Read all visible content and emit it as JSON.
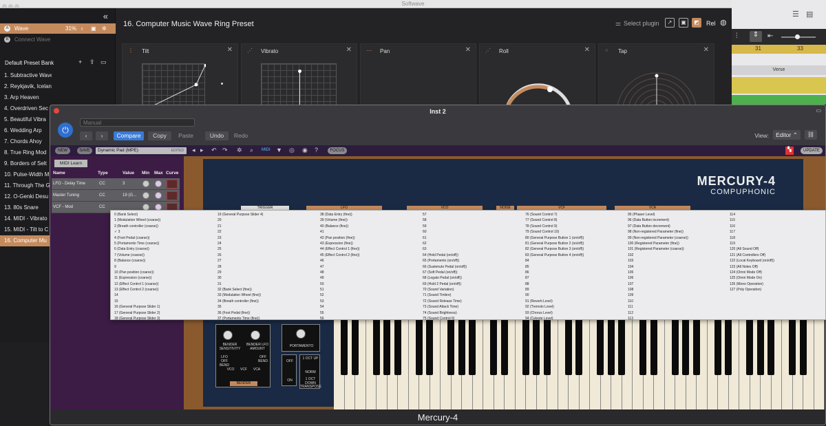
{
  "app": {
    "title": "Softwave"
  },
  "sidebar": {
    "plugins": [
      {
        "badge": "A",
        "name": "Wave",
        "percent": "31%"
      },
      {
        "badge": "B",
        "name": "Connect Wave"
      }
    ],
    "bank": "Default Preset Bank",
    "presets": [
      "1. Subtractive Waves",
      "2. Reykjavik, Iceland",
      "3. Arp Heaven",
      "4. Overdriven Sec",
      "5. Beautiful Vibra",
      "6. Wedding Arp",
      "7. Chords Ahoy",
      "8. True Ring Mod",
      "9. Borders of Selt",
      "10. Pulse-Width M",
      "11. Through The G",
      "12. O-Genki Desu",
      "13. 80s Snare",
      "14. MIDI - Vibrato",
      "15. MIDI - Tilt to C",
      "16. Computer Mu"
    ],
    "selected_index": 15
  },
  "main": {
    "title": "16. Computer Music Wave Ring Preset",
    "select_plugin": "Select plugin",
    "rel_label": "Rel",
    "cards": [
      "Tilt",
      "Vibrato",
      "Pan",
      "Roll",
      "Tap"
    ]
  },
  "daw": {
    "bar31": "31",
    "bar33": "33",
    "section": "Verse"
  },
  "inst": {
    "window_title": "Inst 2",
    "preset_dropdown": "Manual",
    "buttons": {
      "compare": "Compare",
      "copy": "Copy",
      "paste": "Paste",
      "undo": "Undo",
      "redo": "Redo"
    },
    "view_label": "View:",
    "view_value": "Editor",
    "footer": "Mercury-4"
  },
  "mercury": {
    "toolbar": {
      "new": "NEW",
      "save": "SAVE",
      "preset": "Dynamic Pad (MPE)",
      "edited": "EDITED",
      "focus": "FOCUS",
      "update": "UPDATE",
      "midi": "MIDI"
    },
    "midi_learn": "MIDI Learn",
    "table_headers": [
      "Name",
      "Type",
      "Value",
      "Min",
      "Max",
      "Curve"
    ],
    "rows": [
      {
        "name": "LFO - Delay Time",
        "type": "CC",
        "value": "3"
      },
      {
        "name": "Master Tuning",
        "type": "CC",
        "value": "19 (G..."
      },
      {
        "name": "VCF - Mod",
        "type": "CC",
        "value": ""
      }
    ],
    "logo": "MERCURY-4",
    "brand": "COMPUPHONIC",
    "section_labels": [
      "TRIGGER",
      "LFO",
      "VCO",
      "NOISE",
      "VCF",
      "VCA"
    ],
    "bender": {
      "label": "BENDER",
      "sens": "BENDER SENSITIVITY",
      "lfo": "BENDER LFO AMOUNT",
      "lfo_off_bend": "LFO OFF BEND",
      "off_bend": "OFF BEND",
      "vco": "VCO",
      "vcf": "VCF",
      "vca": "VCA"
    },
    "portamento": {
      "label": "PORTAMENTO",
      "off": "OFF",
      "on": "ON"
    },
    "transpose": {
      "label": "TRANSPOSE",
      "up": "1 OCT UP",
      "norm": "NORM",
      "down": "1 OCT DOWN"
    }
  },
  "cc_menu": {
    "columns": [
      [
        "0 (Bank Select)",
        "1 (Modulation Wheel (coarse))",
        "2 (Breath controller (coarse))",
        "✓ 3",
        "4 (Foot Pedal (coarse))",
        "5 (Portamento Time (coarse))",
        "6 (Data Entry (coarse))",
        "7 (Volume (coarse))",
        "8 (Balance (coarse))",
        "9",
        "10 (Pan position (coarse))",
        "11 (Expression (coarse))",
        "12 (Effect Control 1 (coarse))",
        "13 (Effect Control 2 (coarse))",
        "14",
        "15",
        "16 (General Purpose Slider 1)",
        "17 (General Purpose Slider 2)",
        "18 (General Purpose Slider 3)"
      ],
      [
        "19 (General Purpose Slider 4)",
        "20",
        "21",
        "22",
        "23",
        "24",
        "25",
        "26",
        "27",
        "28",
        "29",
        "30",
        "31",
        "32 (Bank Select (fine))",
        "33 (Modulation Wheel (fine))",
        "34 (Breath controller (fine))",
        "35",
        "36 (Foot Pedal (fine))",
        "37 (Portamento Time (fine))"
      ],
      [
        "38 (Data Entry (fine))",
        "39 (Volume (fine))",
        "40 (Balance (fine))",
        "41",
        "42 (Pan position (fine))",
        "43 (Expression (fine))",
        "44 (Effect Control 1 (fine))",
        "45 (Effect Control 2 (fine))",
        "46",
        "47",
        "48",
        "49",
        "50",
        "51",
        "52",
        "53",
        "54",
        "55",
        "56"
      ],
      [
        "57",
        "58",
        "59",
        "60",
        "61",
        "62",
        "63",
        "64 (Hold Pedal (on/off))",
        "65 (Portamento (on/off))",
        "66 (Sustenuto Pedal (on/off))",
        "67 (Soft Pedal (on/off))",
        "68 (Legato Pedal (on/off))",
        "69 (Hold 2 Pedal (on/off))",
        "70 (Sound Variation)",
        "71 (Sound Timbre)",
        "72 (Sound Release Time)",
        "73 (Sound Attack Time)",
        "74 (Sound Brightness)",
        "75 (Sound Control 6)"
      ],
      [
        "76 (Sound Control 7)",
        "77 (Sound Control 8)",
        "78 (Sound Control 9)",
        "79 (Sound Control 10)",
        "80 (General Purpose Button 1 (on/off))",
        "81 (General Purpose Button 2 (on/off))",
        "82 (General Purpose Button 3 (on/off))",
        "83 (General Purpose Button 4 (on/off))",
        "84",
        "85",
        "86",
        "87",
        "88",
        "89",
        "90",
        "91 (Reverb Level)",
        "92 (Tremolo Level)",
        "93 (Chorus Level)",
        "94 (Celeste Level)"
      ],
      [
        "95 (Phaser Level)",
        "96 (Data Button increment)",
        "97 (Data Button decrement)",
        "98 (Non-registered Parameter (fine))",
        "99 (Non-registered Parameter (coarse))",
        "100 (Registered Parameter (fine))",
        "101 (Registered Parameter (coarse))",
        "102",
        "103",
        "104",
        "105",
        "106",
        "107",
        "108",
        "109",
        "110",
        "111",
        "112",
        "113"
      ],
      [
        "114",
        "115",
        "116",
        "117",
        "118",
        "119",
        "120 (All Sound Off)",
        "121 (All Controllers Off)",
        "122 (Local Keyboard (on/off))",
        "123 (All Notes Off)",
        "124 (Omni Mode Off)",
        "125 (Omni Mode On)",
        "126 (Mono Operation)",
        "127 (Poly Operation)"
      ]
    ]
  },
  "colors": {
    "accent": "#c58a5c",
    "blue": "#3a7bd5",
    "close": "#e2493d"
  }
}
